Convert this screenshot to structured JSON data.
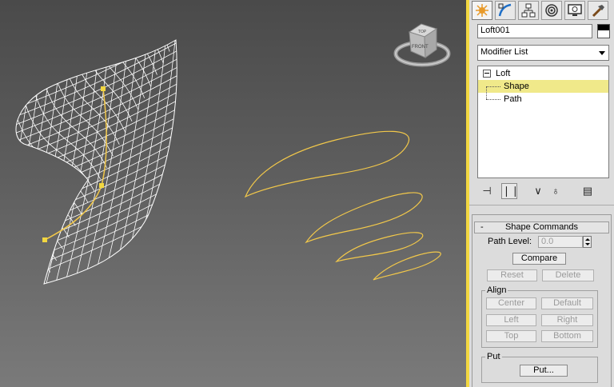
{
  "viewcube": {
    "face_top": "TOP",
    "face_front": "FRONT"
  },
  "command_panel": {
    "tabs": [
      {
        "name": "create-icon",
        "active": true
      },
      {
        "name": "modify-icon",
        "active": false
      },
      {
        "name": "hierarchy-icon",
        "active": false
      },
      {
        "name": "motion-icon",
        "active": false
      },
      {
        "name": "display-icon",
        "active": false
      },
      {
        "name": "utilities-icon",
        "active": false
      }
    ],
    "object_name": "Loft001",
    "modifier_list": "Modifier List",
    "stack": {
      "root": "Loft",
      "items": [
        {
          "label": "Shape",
          "selected": true
        },
        {
          "label": "Path",
          "selected": false
        }
      ]
    },
    "stack_tools": [
      "pin-stack-icon",
      "show-end-result-icon",
      "make-unique-icon",
      "remove-modifier-icon",
      "configure-sets-icon"
    ]
  },
  "shape_commands": {
    "title": "Shape Commands",
    "collapse": "-",
    "path_level_label": "Path Level:",
    "path_level_value": "0.0",
    "compare": "Compare",
    "reset": "Reset",
    "delete": "Delete",
    "align_label": "Align",
    "center": "Center",
    "default": "Default",
    "left": "Left",
    "right": "Right",
    "top": "Top",
    "bottom": "Bottom",
    "put_label": "Put",
    "put_button": "Put..."
  },
  "colors": {
    "accent_yellow": "#f2d740",
    "selection": "#f0e98a",
    "wire": "#ffffff"
  }
}
